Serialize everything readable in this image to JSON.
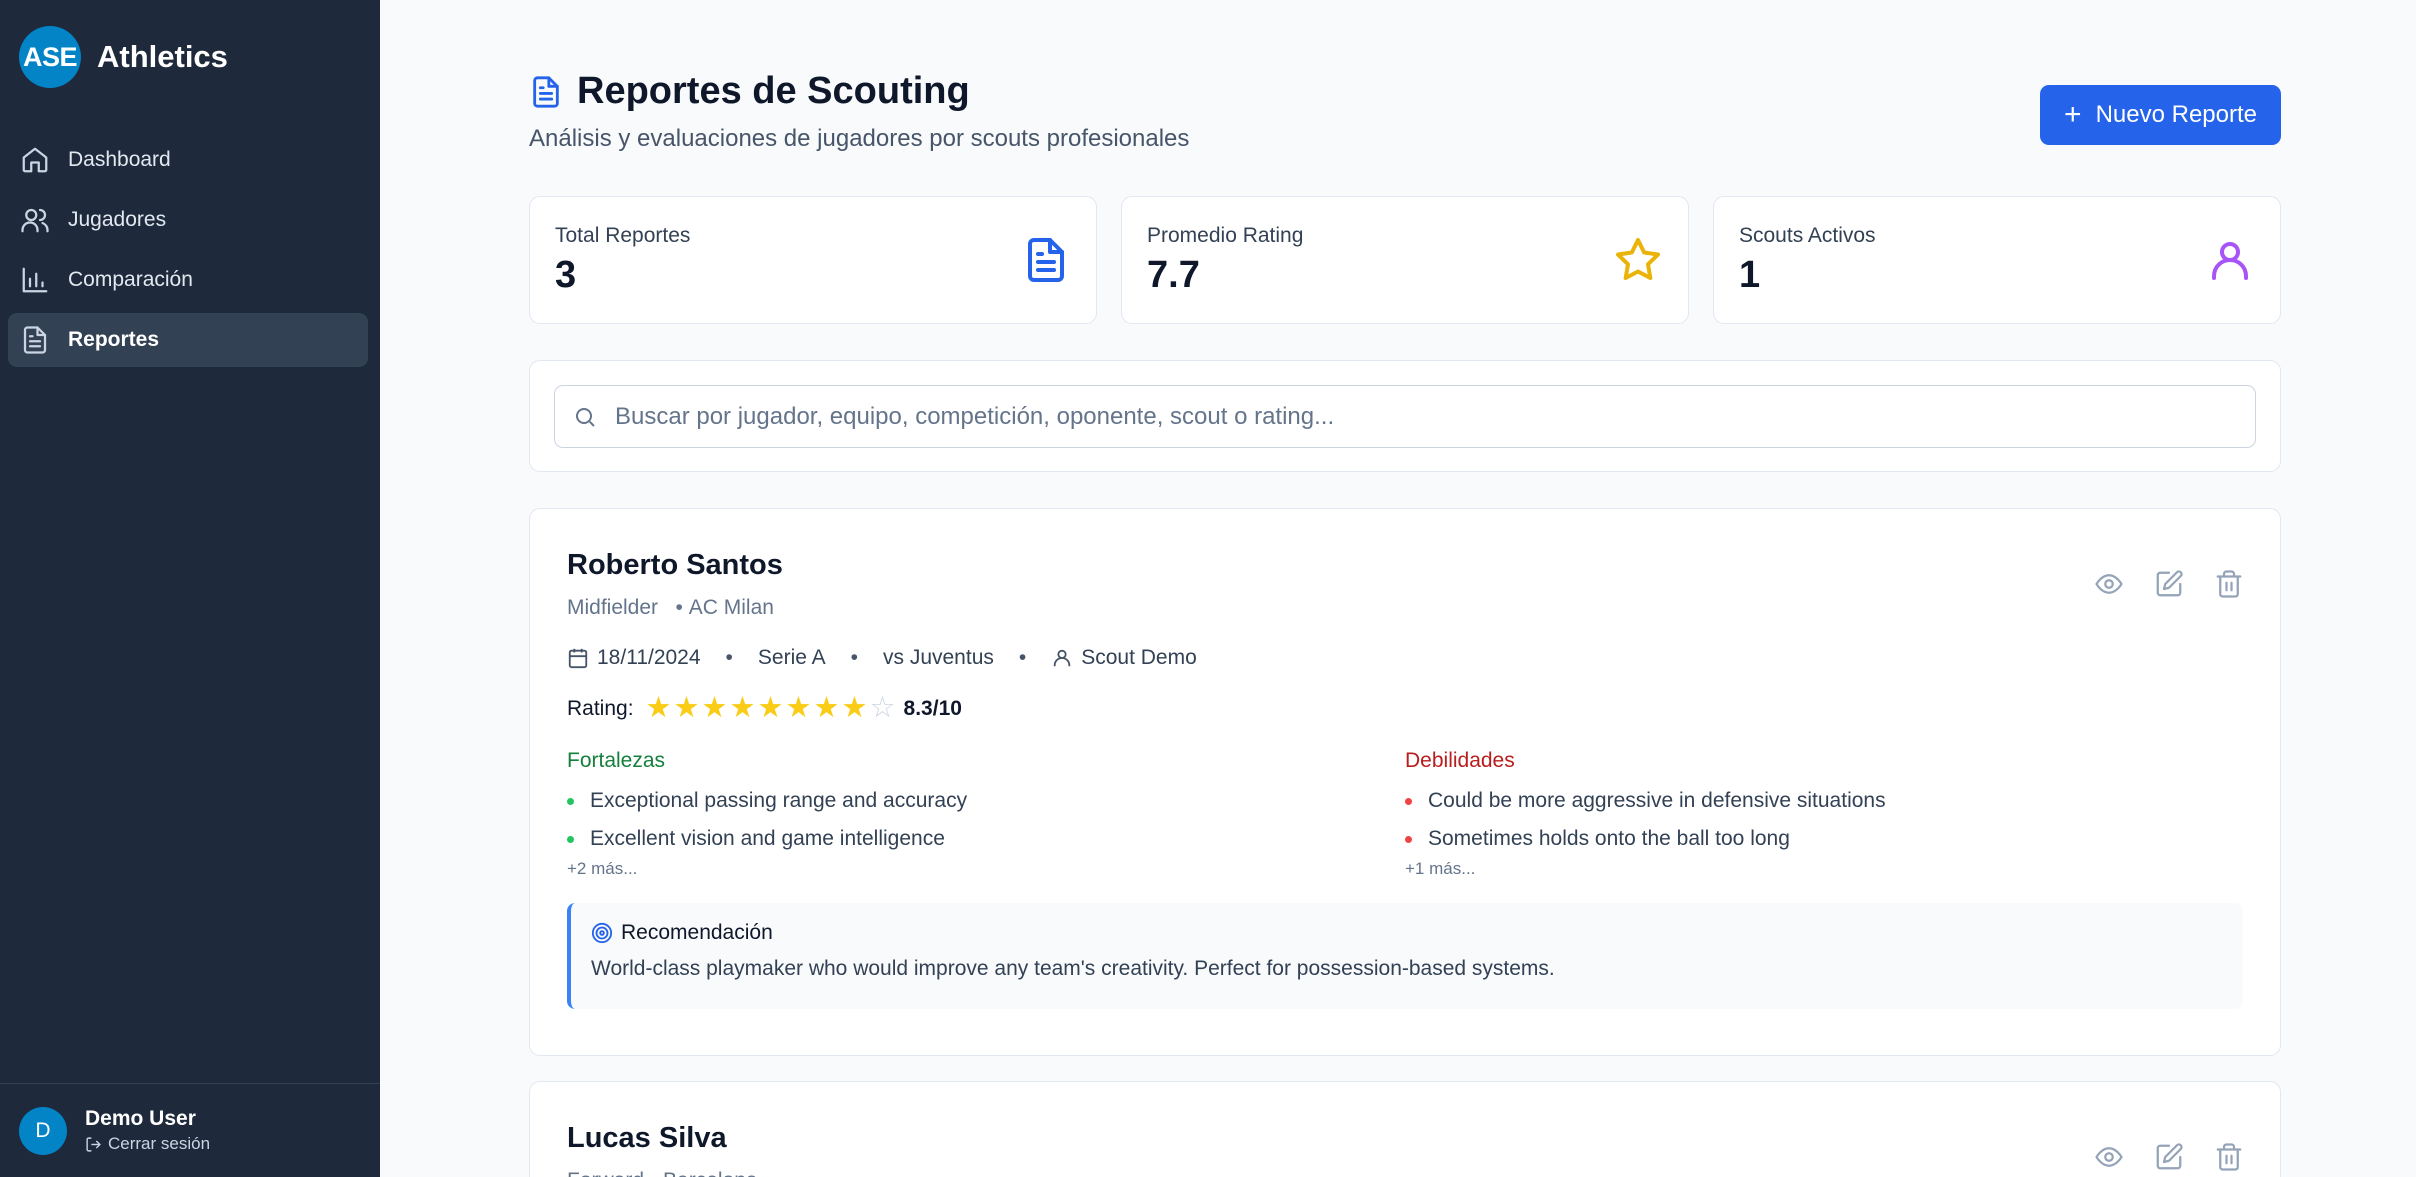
{
  "brand": {
    "logo": "ASE",
    "name": "Athletics"
  },
  "nav": [
    {
      "label": "Dashboard",
      "icon": "home-icon",
      "active": false
    },
    {
      "label": "Jugadores",
      "icon": "users-icon",
      "active": false
    },
    {
      "label": "Comparación",
      "icon": "bar-chart-icon",
      "active": false
    },
    {
      "label": "Reportes",
      "icon": "file-text-icon",
      "active": true
    }
  ],
  "user": {
    "initial": "D",
    "name": "Demo User",
    "logout": "Cerrar sesión"
  },
  "header": {
    "title": "Reportes de Scouting",
    "subtitle": "Análisis y evaluaciones de jugadores por scouts profesionales",
    "new_button": "Nuevo Reporte"
  },
  "stats": [
    {
      "label": "Total Reportes",
      "value": "3",
      "icon": "file-text-icon",
      "color": "#2563eb"
    },
    {
      "label": "Promedio Rating",
      "value": "7.7",
      "icon": "star-icon",
      "color": "#eab308"
    },
    {
      "label": "Scouts Activos",
      "value": "1",
      "icon": "user-icon",
      "color": "#a855f7"
    }
  ],
  "search": {
    "placeholder": "Buscar por jugador, equipo, competición, oponente, scout o rating..."
  },
  "reports": [
    {
      "player": "Roberto Santos",
      "position": "Midfielder",
      "team": "AC Milan",
      "date": "18/11/2024",
      "competition": "Serie A",
      "opponent": "vs Juventus",
      "scout": "Scout Demo",
      "rating_label": "Rating:",
      "rating": 8.3,
      "rating_text": "8.3/10",
      "strengths_title": "Fortalezas",
      "strengths": [
        "Exceptional passing range and accuracy",
        "Excellent vision and game intelligence"
      ],
      "strengths_more": "+2 más...",
      "weaknesses_title": "Debilidades",
      "weaknesses": [
        "Could be more aggressive in defensive situations",
        "Sometimes holds onto the ball too long"
      ],
      "weaknesses_more": "+1 más...",
      "recommendation_title": "Recomendación",
      "recommendation": "World-class playmaker who would improve any team's creativity. Perfect for possession-based systems."
    },
    {
      "player": "Lucas Silva",
      "meta": "Forward • Barcelona"
    }
  ]
}
